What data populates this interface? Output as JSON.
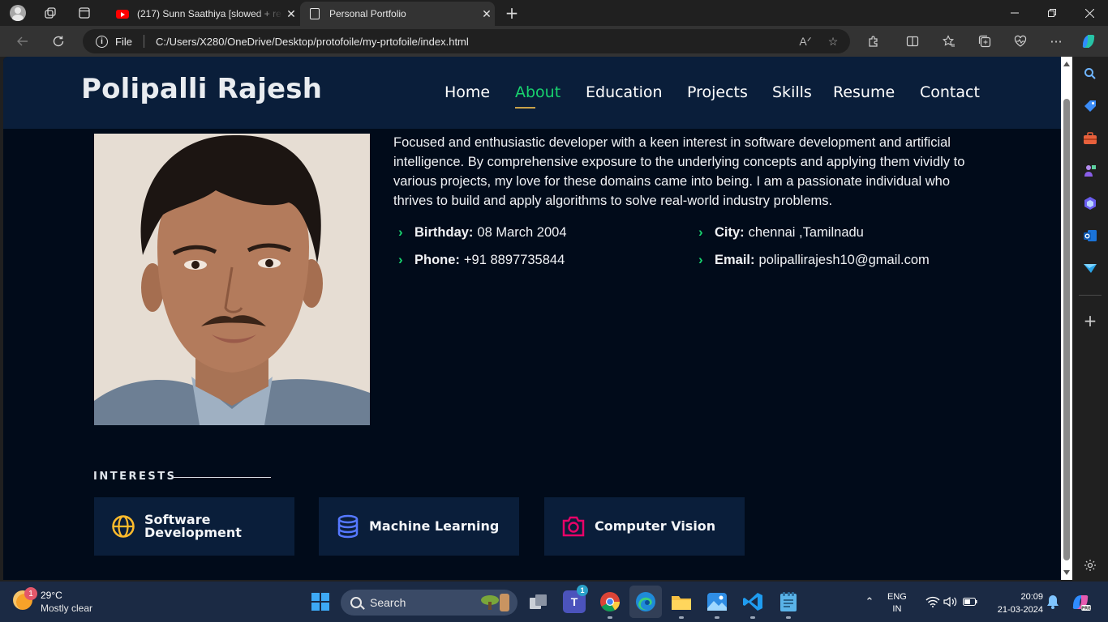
{
  "browser": {
    "tabs": [
      {
        "title": "(217) Sunn Saathiya [slowed + re",
        "active": false
      },
      {
        "title": "Personal Portfolio",
        "active": true
      }
    ],
    "address": {
      "scheme": "File",
      "url": "C:/Users/X280/OneDrive/Desktop/protofoile/my-prtofoile/index.html"
    }
  },
  "site": {
    "logo": "Polipalli Rajesh",
    "nav": [
      {
        "label": "Home",
        "active": false
      },
      {
        "label": "About",
        "active": true
      },
      {
        "label": "Education",
        "active": false
      },
      {
        "label": "Projects",
        "active": false
      },
      {
        "label": "Skills",
        "active": false
      },
      {
        "label": "Resume",
        "active": false
      },
      {
        "label": "Contact",
        "active": false
      }
    ],
    "about": {
      "bio": "Focused and enthusiastic developer with a keen interest in software development and artificial intelligence. By comprehensive exposure to the underlying concepts and applying them vividly to various projects, my love for these domains came into being. I am a passionate individual who thrives to build and apply algorithms to solve real-world industry problems.",
      "info": [
        {
          "label": "Birthday:",
          "value": "08 March 2004"
        },
        {
          "label": "City:",
          "value": "chennai ,Tamilnadu"
        },
        {
          "label": "Phone:",
          "value": "+91 8897735844"
        },
        {
          "label": "Email:",
          "value": "polipallirajesh10@gmail.com"
        }
      ]
    },
    "interests": {
      "title": "INTERESTS",
      "items": [
        {
          "label_line1": "Software",
          "label_line2": "Development",
          "icon": "globe-icon",
          "color": "#ffbb2c"
        },
        {
          "label_line1": "Machine Learning",
          "label_line2": "",
          "icon": "database-icon",
          "color": "#5578ff"
        },
        {
          "label_line1": "Computer Vision",
          "label_line2": "",
          "icon": "camera-icon",
          "color": "#e80368"
        }
      ]
    }
  },
  "colors": {
    "accent": "#18d26e",
    "header_bg": "#0a1e3a",
    "page_bg": "#010b1a"
  },
  "taskbar": {
    "weather": {
      "temp": "29°C",
      "desc": "Mostly clear",
      "badge": "1"
    },
    "search_label": "Search",
    "teams_badge": "1",
    "lang": {
      "line1": "ENG",
      "line2": "IN"
    },
    "clock": {
      "time": "20:09",
      "date": "21-03-2024"
    }
  }
}
